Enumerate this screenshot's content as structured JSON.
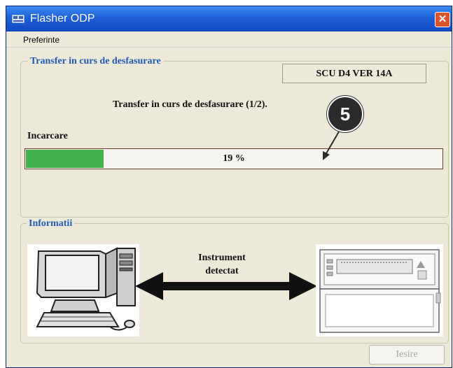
{
  "window": {
    "title": "Flasher ODP",
    "close_symbol": "✕"
  },
  "menu": {
    "items": [
      "Preferinte"
    ]
  },
  "transfer_group": {
    "title": "Transfer in curs de desfasurare",
    "version": "SCU D4 VER  14A",
    "status": "Transfer in curs de desfasurare (1/2).",
    "load_label": "Incarcare",
    "progress_percent": 19,
    "progress_text": "19 %",
    "callout_number": "5",
    "accent_color": "#44b24a"
  },
  "info_group": {
    "title": "Informatii",
    "detect_line1": "Instrument",
    "detect_line2": "detectat",
    "left_image": "computer-icon",
    "right_image": "instrument-device-icon"
  },
  "footer": {
    "exit_label": "Iesire"
  }
}
